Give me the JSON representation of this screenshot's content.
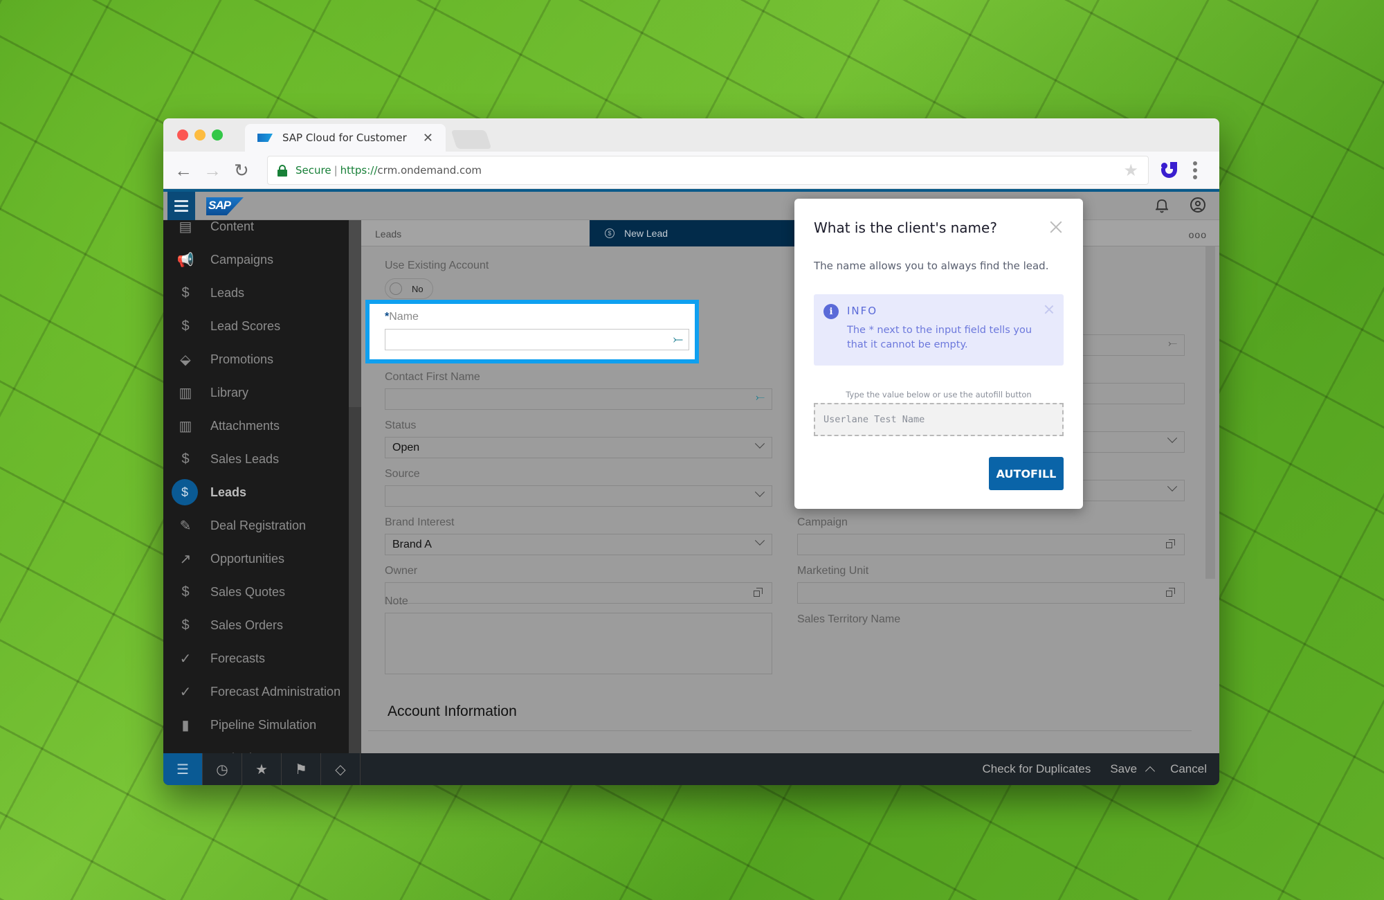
{
  "browser": {
    "tab_title": "SAP Cloud for Customer",
    "url_secure_label": "Secure",
    "url_scheme": "https://",
    "url_host": "crm.ondemand.com"
  },
  "shell": {
    "logo_text": "SAP"
  },
  "sidebar": {
    "items": [
      {
        "label": "Content",
        "icon": "document-icon",
        "glyph": "▤",
        "active": false
      },
      {
        "label": "Campaigns",
        "icon": "megaphone-icon",
        "glyph": "📢",
        "active": false
      },
      {
        "label": "Leads",
        "icon": "lead-icon",
        "glyph": "$",
        "active": false
      },
      {
        "label": "Lead Scores",
        "icon": "lead-score-icon",
        "glyph": "$",
        "active": false
      },
      {
        "label": "Promotions",
        "icon": "price-tag-icon",
        "glyph": "⬙",
        "active": false
      },
      {
        "label": "Library",
        "icon": "library-icon",
        "glyph": "▥",
        "active": false
      },
      {
        "label": "Attachments",
        "icon": "attachment-icon",
        "glyph": "▥",
        "active": false
      },
      {
        "label": "Sales Leads",
        "icon": "dollar-circle-icon",
        "glyph": "$",
        "active": false
      },
      {
        "label": "Leads",
        "icon": "lead-icon",
        "glyph": "$",
        "active": true
      },
      {
        "label": "Deal Registration",
        "icon": "signature-icon",
        "glyph": "✎",
        "active": false
      },
      {
        "label": "Opportunities",
        "icon": "opportunity-icon",
        "glyph": "↗",
        "active": false
      },
      {
        "label": "Sales Quotes",
        "icon": "quote-icon",
        "glyph": "$",
        "active": false
      },
      {
        "label": "Sales Orders",
        "icon": "sales-order-icon",
        "glyph": "$",
        "active": false
      },
      {
        "label": "Forecasts",
        "icon": "forecast-icon",
        "glyph": "✓",
        "active": false
      },
      {
        "label": "Forecast Administration",
        "icon": "forecast-icon",
        "glyph": "✓",
        "active": false
      },
      {
        "label": "Pipeline Simulation",
        "icon": "pipeline-icon",
        "glyph": "▮",
        "active": false
      },
      {
        "label": "Territories",
        "icon": "territory-icon",
        "glyph": "⌾",
        "active": false
      }
    ],
    "footer_buttons": [
      {
        "name": "list-icon",
        "glyph": "☰",
        "active": true
      },
      {
        "name": "clock-icon",
        "glyph": "◷",
        "active": false
      },
      {
        "name": "star-icon",
        "glyph": "★",
        "active": false
      },
      {
        "name": "flag-icon",
        "glyph": "⚑",
        "active": false
      },
      {
        "name": "tag-icon",
        "glyph": "◇",
        "active": false
      }
    ]
  },
  "content": {
    "breadcrumb": "Leads",
    "active_tab": "New Lead",
    "overflow": "ooo",
    "fields": {
      "use_existing_account": {
        "label": "Use Existing Account",
        "value": "No"
      },
      "name": {
        "label": "Name",
        "required_mark": "*",
        "value": ""
      },
      "contact_first_name": {
        "label": "Contact First Name",
        "value": ""
      },
      "status": {
        "label": "Status",
        "value": "Open"
      },
      "source": {
        "label": "Source",
        "value": ""
      },
      "brand_interest": {
        "label": "Brand Interest",
        "value": "Brand A"
      },
      "owner": {
        "label": "Owner",
        "value": ""
      },
      "note": {
        "label": "Note",
        "value": ""
      },
      "campaign": {
        "label": "Campaign",
        "value": ""
      },
      "marketing_unit": {
        "label": "Marketing Unit",
        "value": ""
      },
      "sales_territory_name": {
        "label": "Sales Territory Name",
        "value": ""
      }
    },
    "section_title": "Account Information"
  },
  "footer": {
    "check_duplicates": "Check for Duplicates",
    "save": "Save",
    "cancel": "Cancel"
  },
  "dialog": {
    "title": "What is the client's name?",
    "description": "The name allows you to always find the lead.",
    "info_title": "INFO",
    "info_text": "The * next to the input field tells you that it cannot be empty.",
    "hint": "Type the value below or use the autofill button",
    "value": "Userlane Test Name",
    "autofill_label": "AUTOFILL"
  },
  "colors": {
    "highlight": "#0fa0f0",
    "sap_blue": "#0a64a8",
    "info_bg": "#e8eafc",
    "info_accent": "#5a6ad8"
  }
}
